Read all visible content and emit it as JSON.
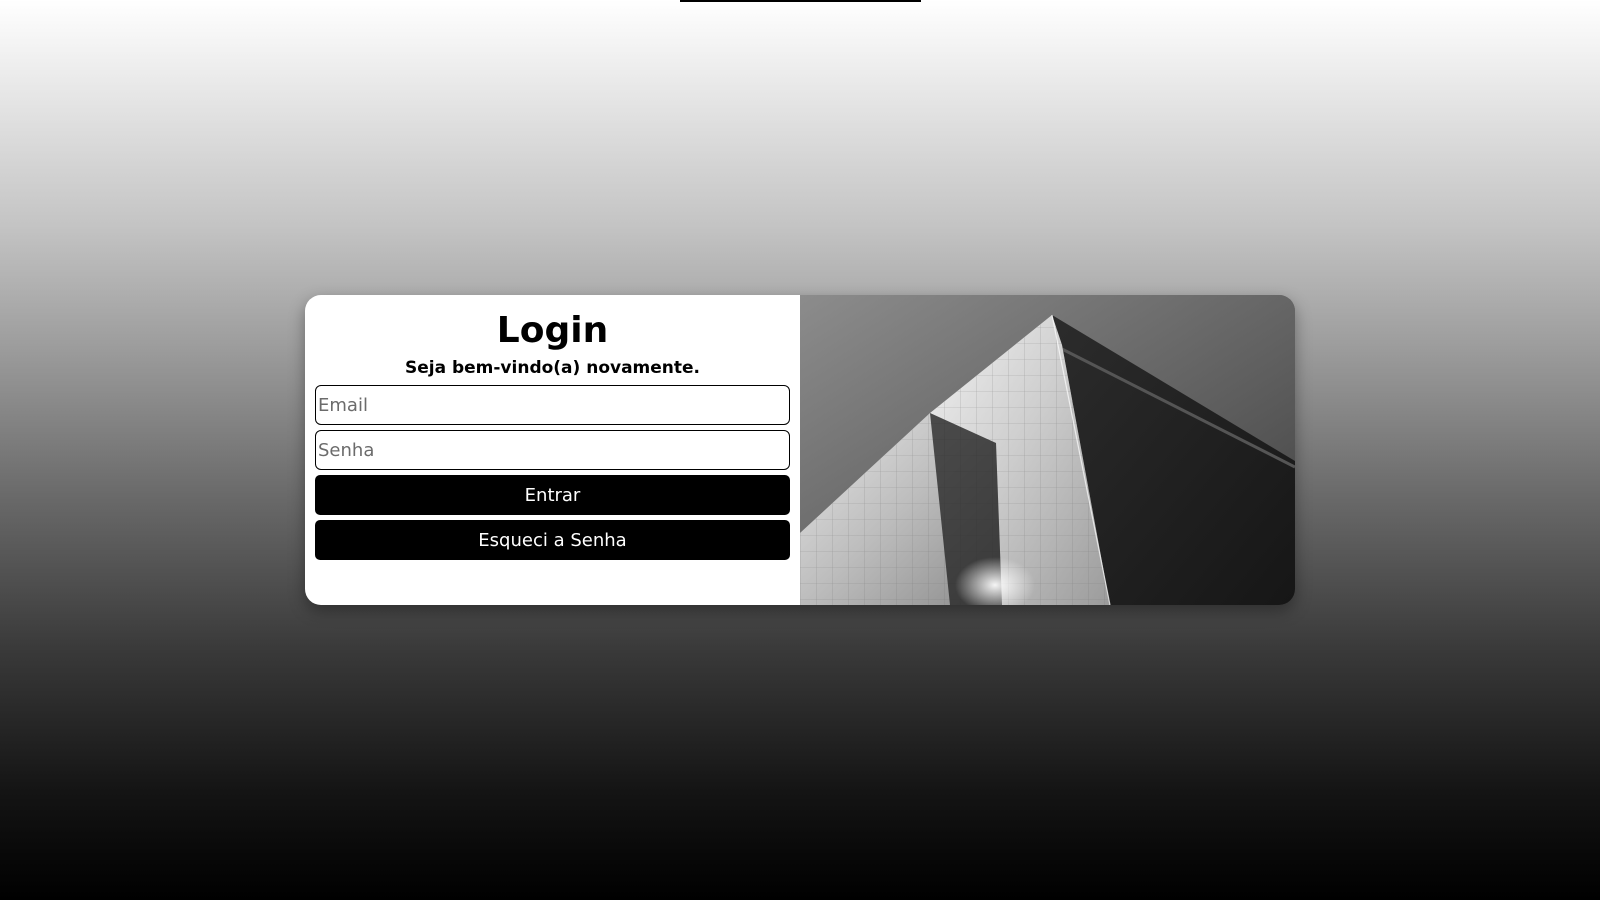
{
  "login": {
    "title": "Login",
    "subtitle": "Seja bem-vindo(a) novamente.",
    "email_placeholder": "Email",
    "password_placeholder": "Senha",
    "submit_label": "Entrar",
    "forgot_label": "Esqueci a Senha"
  },
  "image": {
    "subject": "building-photo"
  },
  "colors": {
    "button_bg": "#000000",
    "button_text": "#ffffff",
    "panel_bg": "#ffffff"
  }
}
